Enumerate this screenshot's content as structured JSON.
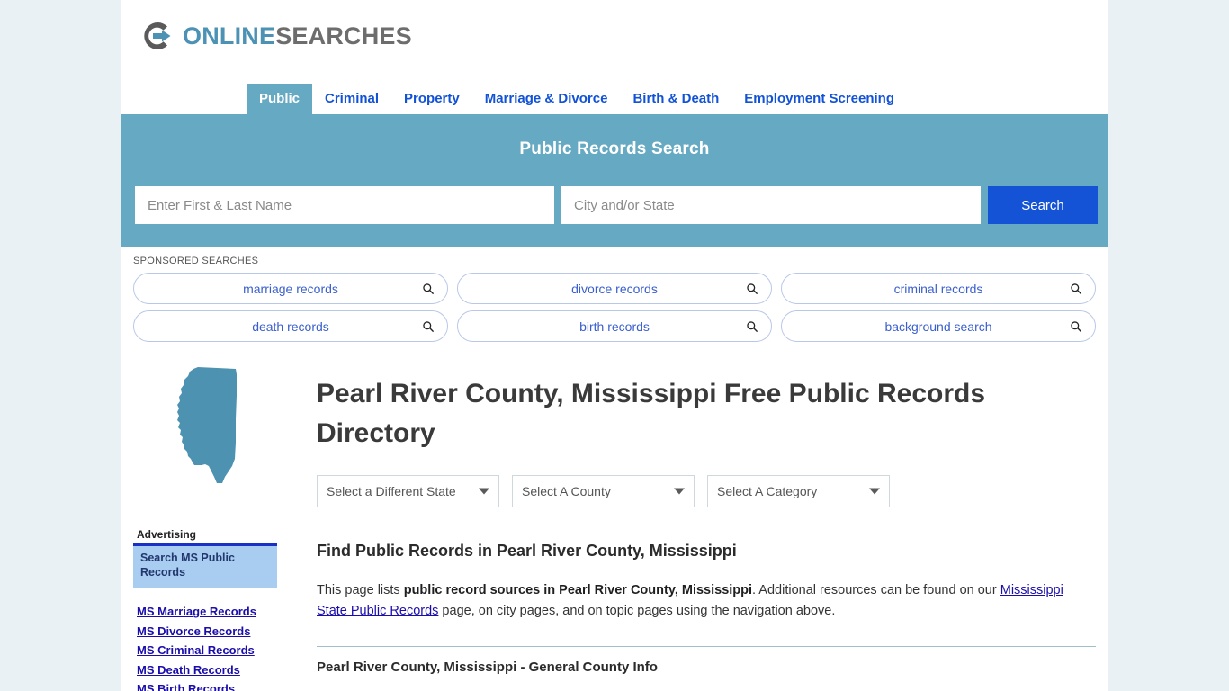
{
  "brand": {
    "logo_online": "ONLINE",
    "logo_searches": "SEARCHES",
    "logo_icon": "circle-arrow-logo-icon",
    "accent_teal": "#66a9c2",
    "accent_blue": "#1452d6",
    "link_blue": "#1a0dab"
  },
  "nav": {
    "items": [
      {
        "label": "Public",
        "active": true
      },
      {
        "label": "Criminal",
        "active": false
      },
      {
        "label": "Property",
        "active": false
      },
      {
        "label": "Marriage & Divorce",
        "active": false
      },
      {
        "label": "Birth & Death",
        "active": false
      },
      {
        "label": "Employment Screening",
        "active": false
      }
    ]
  },
  "hero": {
    "title": "Public Records Search",
    "name_placeholder": "Enter First & Last Name",
    "name_value": "",
    "place_placeholder": "City and/or State",
    "place_value": "",
    "search_button": "Search"
  },
  "sponsored": {
    "label": "SPONSORED SEARCHES",
    "items": [
      {
        "label": "marriage records",
        "icon": "search-icon"
      },
      {
        "label": "divorce records",
        "icon": "search-icon"
      },
      {
        "label": "criminal records",
        "icon": "search-icon"
      },
      {
        "label": "death records",
        "icon": "search-icon"
      },
      {
        "label": "birth records",
        "icon": "search-icon"
      },
      {
        "label": "background search",
        "icon": "search-icon"
      }
    ]
  },
  "sidebar": {
    "state_shape_icon": "mississippi-state-map-icon",
    "advertising_label": "Advertising",
    "ad_box_text": "Search MS Public Records",
    "links": [
      "MS Marriage Records",
      "MS Divorce Records",
      "MS Criminal Records",
      "MS Death Records",
      "MS Birth Records"
    ]
  },
  "main": {
    "page_title": "Pearl River County, Mississippi Free Public Records Directory",
    "selects": [
      {
        "value": "Select a Different State"
      },
      {
        "value": "Select A County"
      },
      {
        "value": "Select A Category"
      }
    ],
    "section_title": "Find Public Records in Pearl River County, Mississippi",
    "intro_part1": "This page lists ",
    "intro_bold": "public record sources in Pearl River County, Mississippi",
    "intro_part2": ". Additional resources can be found on our ",
    "intro_link": "Mississippi State Public Records",
    "intro_part3": " page, on city pages, and on topic pages using the navigation above.",
    "county_info_title": "Pearl River County, Mississippi - General County Info"
  }
}
